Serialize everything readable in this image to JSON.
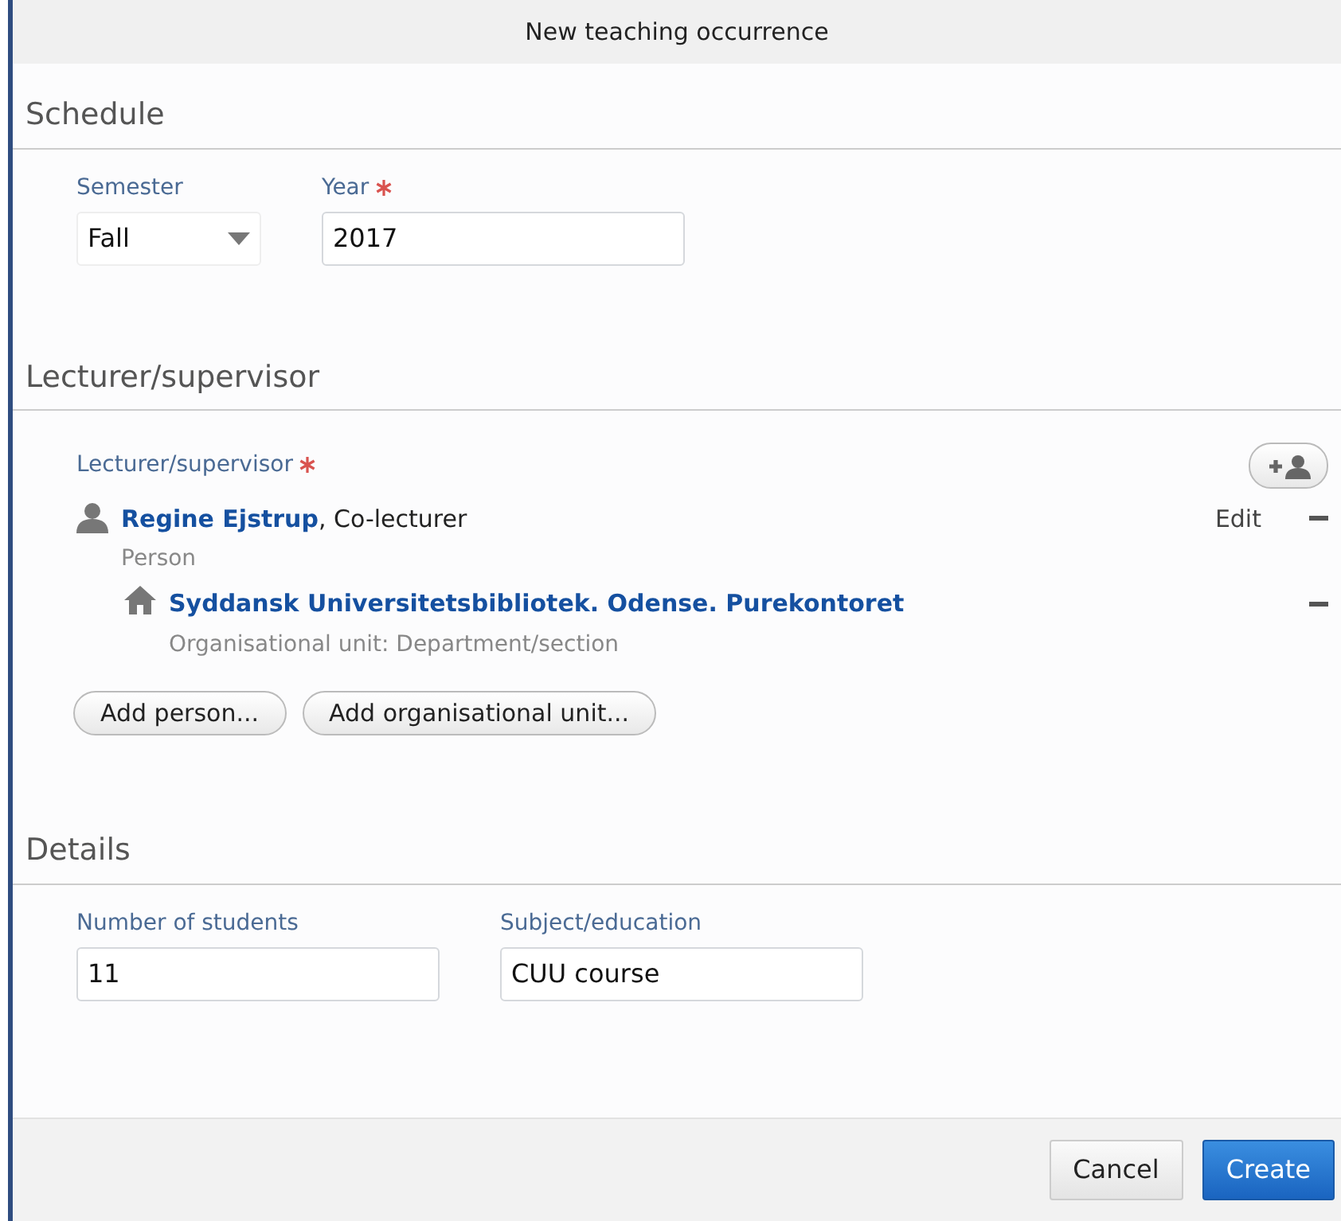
{
  "window": {
    "title": "New teaching occurrence"
  },
  "schedule": {
    "heading": "Schedule",
    "fields": [
      {
        "kind": "select",
        "label": "Semester",
        "value": "Fall",
        "required": false
      },
      {
        "kind": "text",
        "label": "Year",
        "value": "2017",
        "required": true
      }
    ]
  },
  "lecturers": {
    "heading": "Lecturer/supervisor",
    "label": "Lecturer/supervisor",
    "required": true,
    "entries": [
      {
        "kind": "person",
        "name": "Regine Ejstrup",
        "role": ", Co-lecturer",
        "type": "Person",
        "edit": "Edit"
      },
      {
        "kind": "unit",
        "name": "Syddansk Universitetsbibliotek. Odense. Purekontoret",
        "type": "Organisational unit: Department/section"
      }
    ],
    "buttons": [
      "Add person...",
      "Add organisational unit..."
    ]
  },
  "details": {
    "heading": "Details",
    "fields": [
      {
        "label": "Number of students",
        "value": "11",
        "required": false
      },
      {
        "label": "Subject/education",
        "value": "CUU course",
        "required": false
      }
    ]
  },
  "footer": {
    "buttons": [
      {
        "label": "Cancel",
        "primary": false
      },
      {
        "label": "Create",
        "primary": true
      }
    ]
  }
}
